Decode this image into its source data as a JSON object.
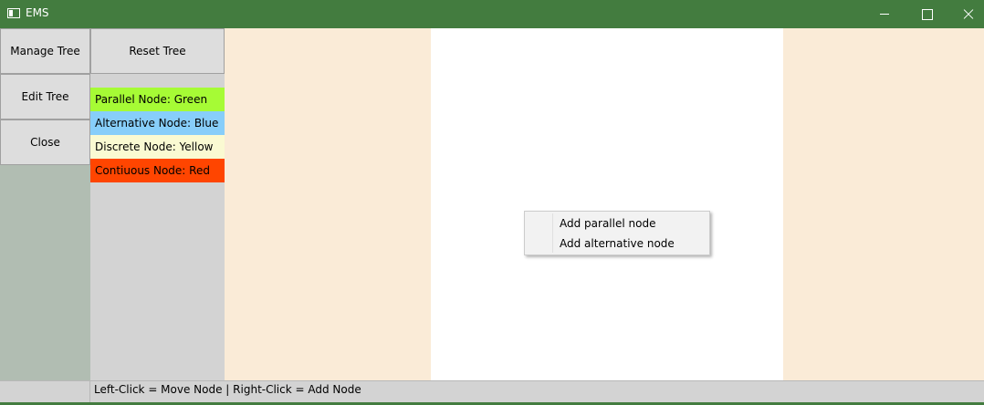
{
  "window": {
    "title": "EMS"
  },
  "nav": {
    "manage_tree": "Manage Tree",
    "edit_tree": "Edit Tree",
    "close": "Close",
    "reset_tree": "Reset Tree"
  },
  "legend": [
    {
      "label": "Parallel Node: Green",
      "color": "#a6fb35"
    },
    {
      "label": "Alternative Node: Blue",
      "color": "#87cefa"
    },
    {
      "label": "Discrete Node: Yellow",
      "color": "#fafad2"
    },
    {
      "label": "Contiuous Node: Red",
      "color": "#ff4500"
    }
  ],
  "canvas": {
    "side_color": "#faebd7",
    "center_color": "#ffffff"
  },
  "context_menu": {
    "items": [
      "Add parallel node",
      "Add alternative node"
    ]
  },
  "status": {
    "text": "Left-Click = Move Node | Right-Click = Add Node"
  },
  "colors": {
    "titlebar": "#437c3f",
    "left_panel": "#b1bdb2",
    "mid_panel": "#d3d3d3"
  }
}
